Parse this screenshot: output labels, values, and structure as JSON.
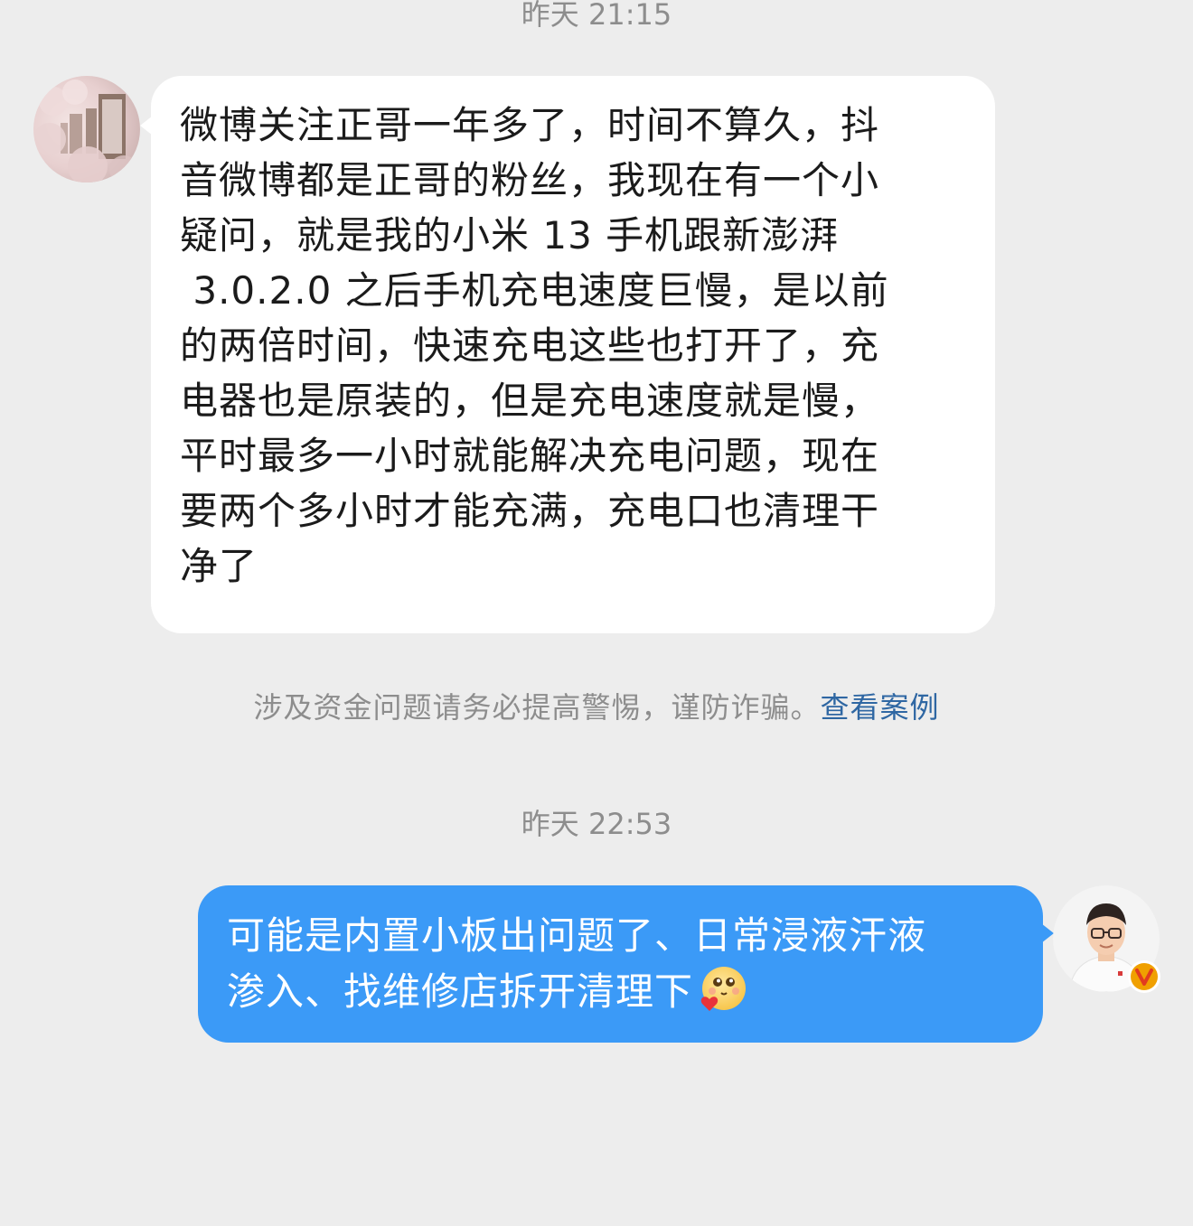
{
  "conversation": {
    "timestamp_1": "昨天 21:15",
    "timestamp_2": "昨天 22:53",
    "incoming": {
      "lines": [
        "微博关注正哥一年多了，时间不算久，抖",
        "音微博都是正哥的粉丝，我现在有一个小",
        "疑问，就是我的小米 13 手机跟新澎湃",
        " 3.0.2.0 之后手机充电速度巨慢，是以前",
        "的两倍时间，快速充电这些也打开了，充",
        "电器也是原装的，但是充电速度就是慢，",
        "平时最多一小时就能解决充电问题，现在",
        "要两个多小时才能充满，充电口也清理干",
        "净了"
      ]
    },
    "safety_notice": {
      "text": "涉及资金问题请务必提高警惕，谨防诈骗。",
      "link": "查看案例"
    },
    "outgoing": {
      "lines": [
        "可能是内置小板出问题了、日常浸液汗液",
        "渗入、找维修店拆开清理下"
      ],
      "emoji": "blush-with-heart-emoji"
    }
  },
  "colors": {
    "background": "#ededed",
    "incoming_bubble": "#ffffff",
    "outgoing_bubble": "#3b9af7",
    "timestamp_text": "#8d8d8d",
    "link": "#2f67a3",
    "verified_badge": "#f0a000"
  },
  "icons": {
    "left_avatar": "cherry-blossom-photo-avatar",
    "right_avatar": "man-with-glasses-avatar",
    "badge": "verified-v-badge-icon"
  }
}
